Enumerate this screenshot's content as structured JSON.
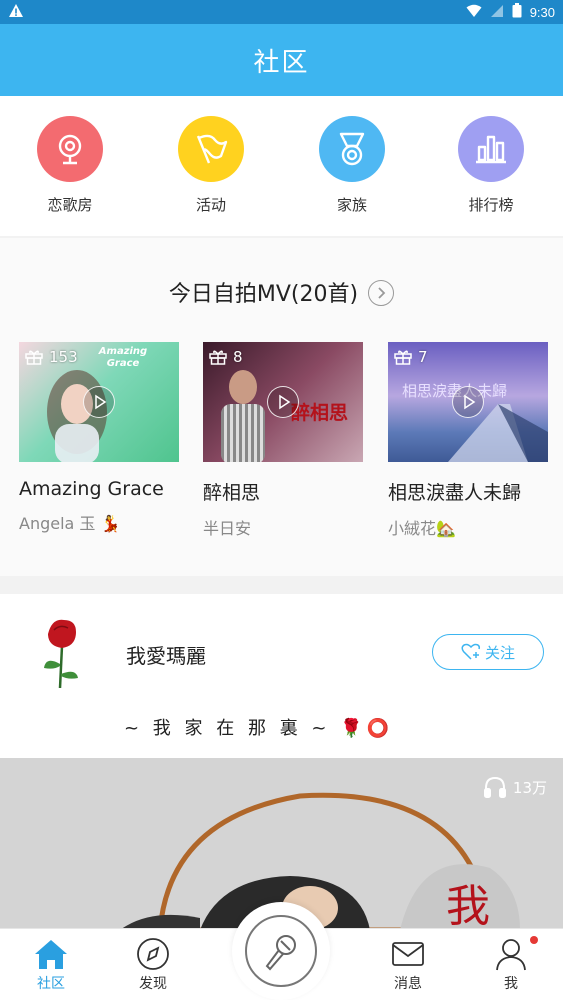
{
  "status_bar": {
    "time": "9:30"
  },
  "app_bar": {
    "title": "社区"
  },
  "shortcuts": [
    {
      "label": "恋歌房",
      "icon": "webcam-icon",
      "color": "#f36b70"
    },
    {
      "label": "活动",
      "icon": "flag-icon",
      "color": "#ffd21f"
    },
    {
      "label": "家族",
      "icon": "medal-icon",
      "color": "#4fb8f3"
    },
    {
      "label": "排行榜",
      "icon": "bar-chart-icon",
      "color": "#9f9ff2"
    }
  ],
  "mv_section": {
    "title": "今日自拍MV(20首)",
    "items": [
      {
        "count": "153",
        "title": "Amazing Grace",
        "author": "Angela 玉 💃 ",
        "thumb_text": "Amazing Grace"
      },
      {
        "count": "8",
        "title": "醉相思",
        "author": "半日安",
        "thumb_text": "醉相思"
      },
      {
        "count": "7",
        "title": "相思淚盡人未歸",
        "author": "小絨花🏡",
        "thumb_text": "相思淚盡人未歸"
      }
    ]
  },
  "post": {
    "name": "我愛瑪麗",
    "follow_label": "关注",
    "caption": "~ 我 家 在 那 裏 ~ 🌹⭕",
    "play_count": "13万",
    "media_text": "我"
  },
  "tabs": [
    {
      "label": "社区",
      "icon": "home-icon",
      "active": true
    },
    {
      "label": "发现",
      "icon": "compass-icon"
    },
    {
      "label": "消息",
      "icon": "mail-icon"
    },
    {
      "label": "我",
      "icon": "user-icon"
    }
  ],
  "colors": {
    "primary": "#3db5f0",
    "status_bar": "#1e88c9",
    "notification_dot": "#e53935"
  }
}
